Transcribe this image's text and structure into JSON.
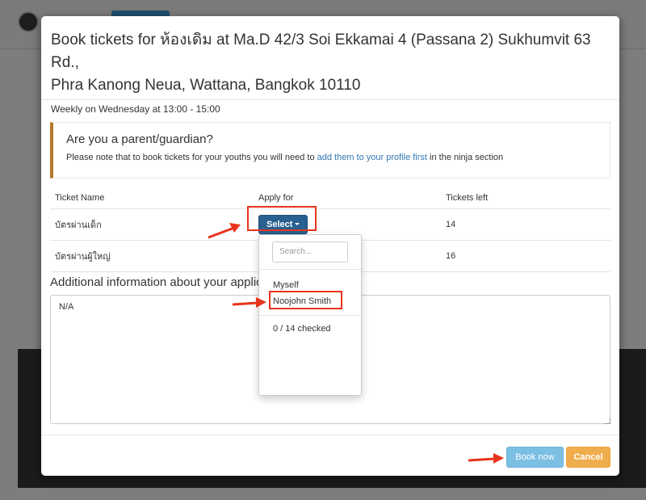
{
  "modal": {
    "title_line1": "Book tickets for ห้องเดิม at Ma.D 42/3 Soi Ekkamai 4 (Passana 2) Sukhumvit 63 Rd.,",
    "title_line2": "Phra Kanong Neua, Wattana, Bangkok 10110",
    "schedule": "Weekly on Wednesday at 13:00 - 15:00"
  },
  "notice": {
    "title": "Are you a parent/guardian?",
    "text_before": "Please note that to book tickets for your youths you will need to ",
    "link": "add them to your profile first",
    "text_after": " in the ninja section"
  },
  "tickets": {
    "headers": [
      "Ticket Name",
      "Apply for",
      "Tickets left"
    ],
    "rows": [
      {
        "name": "บัตรผ่านเด็ก",
        "apply": "Select",
        "left": "14"
      },
      {
        "name": "บัตรผ่านผู้ใหญ่",
        "apply": "",
        "left": "16"
      }
    ]
  },
  "additional": {
    "label": "Additional information about your application",
    "value": "N/A"
  },
  "dropdown": {
    "search_placeholder": "Search...",
    "options": [
      "Myself",
      "Noojohn Smith"
    ],
    "checked_status": "0 / 14 checked"
  },
  "footer": {
    "book_label": "Book now",
    "cancel_label": "Cancel"
  },
  "colors": {
    "primary": "#286090",
    "book": "#7bbfe3",
    "cancel": "#f0ad4e",
    "notice_accent": "#b4782c",
    "annotation": "#e8341c"
  }
}
